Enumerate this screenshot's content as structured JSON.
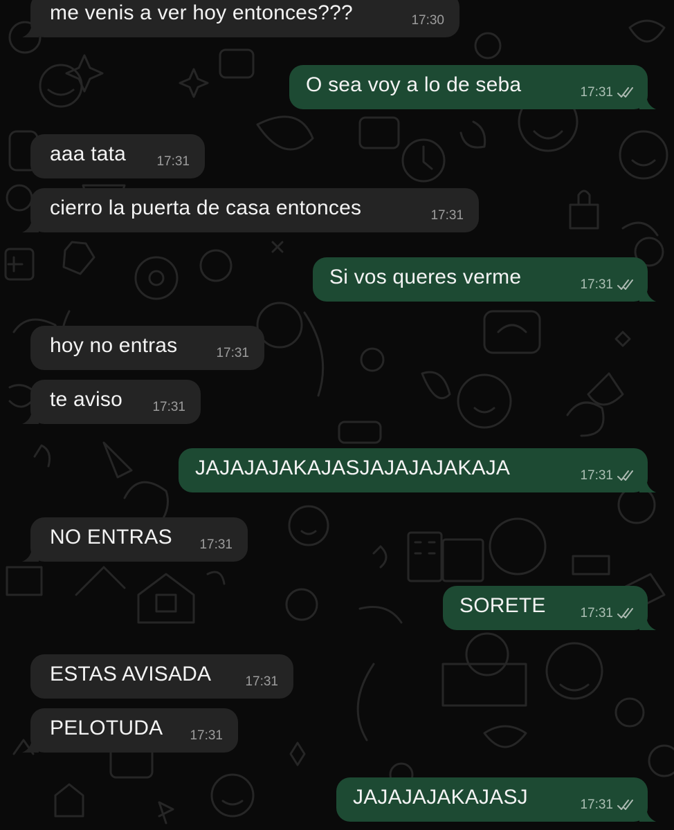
{
  "colors": {
    "background": "#0a0a0a",
    "incoming_bubble": "#242424",
    "outgoing_bubble": "#1d4a33",
    "text": "#f3f3f3",
    "meta_text": "#a9b3ad"
  },
  "messages": [
    {
      "direction": "in",
      "text": "me venis a ver hoy entonces???",
      "time": "17:30"
    },
    {
      "direction": "out",
      "text": "O sea voy a lo de seba",
      "time": "17:31",
      "status": "read-double-check-icon"
    },
    {
      "direction": "in",
      "text": "aaa tata",
      "time": "17:31"
    },
    {
      "direction": "in",
      "text": "cierro la puerta de casa entonces",
      "time": "17:31"
    },
    {
      "direction": "out",
      "text": "Si vos queres verme",
      "time": "17:31",
      "status": "read-double-check-icon"
    },
    {
      "direction": "in",
      "text": "hoy no entras",
      "time": "17:31"
    },
    {
      "direction": "in",
      "text": "te aviso",
      "time": "17:31"
    },
    {
      "direction": "out",
      "text": "JAJAJAJAKAJASJAJAJAJAKAJA",
      "time": "17:31",
      "status": "read-double-check-icon"
    },
    {
      "direction": "in",
      "text": "NO ENTRAS",
      "time": "17:31"
    },
    {
      "direction": "out",
      "text": "SORETE",
      "time": "17:31",
      "status": "read-double-check-icon"
    },
    {
      "direction": "in",
      "text": "ESTAS AVISADA",
      "time": "17:31"
    },
    {
      "direction": "in",
      "text": "PELOTUDA",
      "time": "17:31"
    },
    {
      "direction": "out",
      "text": "JAJAJAJAKAJASJ",
      "time": "17:31",
      "status": "read-double-check-icon"
    }
  ]
}
